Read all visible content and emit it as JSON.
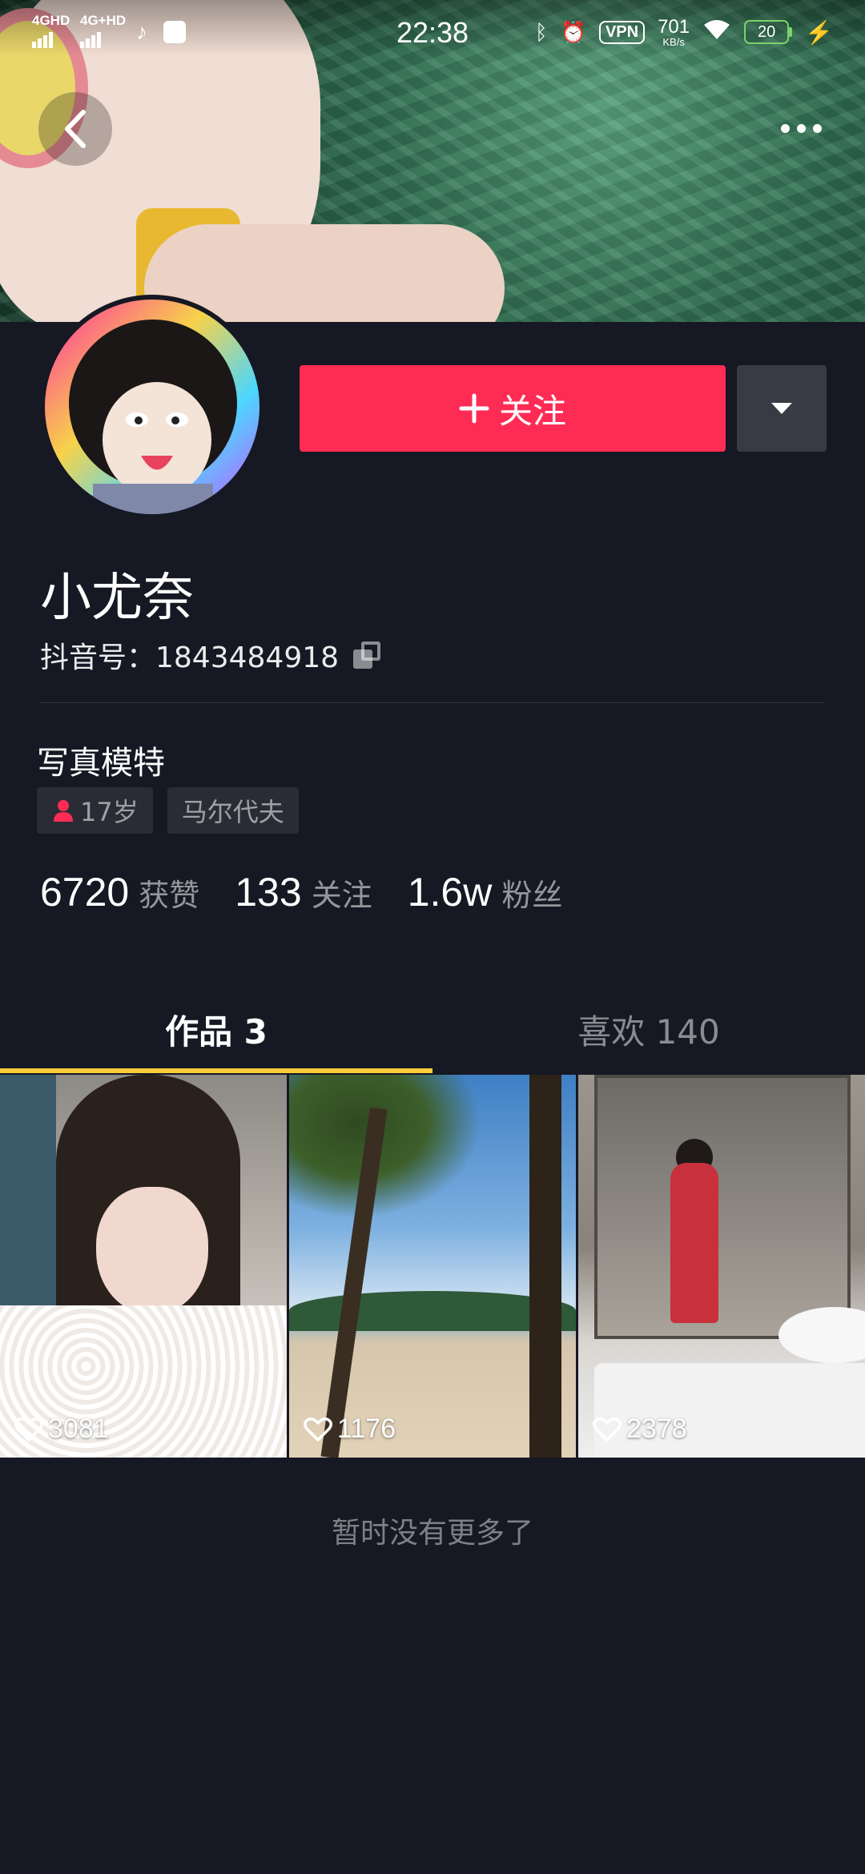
{
  "status_bar": {
    "signal1_label": "4GHD",
    "signal2_label": "4G+HD",
    "time": "22:38",
    "vpn_label": "VPN",
    "net_speed_value": "701",
    "net_speed_unit": "KB/s",
    "battery_level": "20",
    "battery_color": "#7bd16b"
  },
  "header": {
    "back_icon": "chevron-left-icon",
    "more_icon": "more-dots-icon"
  },
  "profile": {
    "follow_label": "关注",
    "follow_color": "#fe2c55",
    "name": "小尤奈",
    "douyin_id": "抖音号：1843484918",
    "bio": "写真模特",
    "tags": [
      {
        "label": "17岁",
        "icon": "female-person-icon"
      },
      {
        "label": "马尔代夫"
      }
    ],
    "stats": [
      {
        "value": "6720",
        "label": "获赞"
      },
      {
        "value": "133",
        "label": "关注"
      },
      {
        "value": "1.6w",
        "label": "粉丝"
      }
    ]
  },
  "tabs": [
    {
      "label": "作品 3",
      "active": true
    },
    {
      "label": "喜欢 140",
      "active": false
    }
  ],
  "tab_indicator_color": "#facd3a",
  "videos": [
    {
      "likes": "3081"
    },
    {
      "likes": "1176"
    },
    {
      "likes": "2378"
    }
  ],
  "footer_text": "暂时没有更多了"
}
